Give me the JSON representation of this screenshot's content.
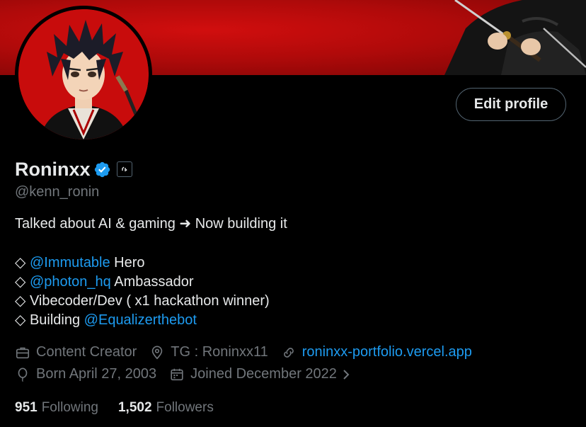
{
  "profile": {
    "display_name": "Roninxx",
    "handle": "@kenn_ronin",
    "edit_button_label": "Edit profile",
    "verified_icon": "verified-badge-icon",
    "affiliate_icon": "affiliate-badge-icon"
  },
  "bio": {
    "line1": "Talked about AI & gaming ➜ Now building it",
    "items": [
      {
        "bullet": "◇",
        "mention": "@Immutable",
        "text": " Hero"
      },
      {
        "bullet": "◇",
        "mention": "@photon_hq",
        "text": " Ambassador"
      },
      {
        "bullet": "◇",
        "mention": "",
        "text": "Vibecoder/Dev ( x1 hackathon winner)"
      },
      {
        "bullet": "◇",
        "pre": "Building ",
        "mention": "@Equalizerthebot",
        "text": ""
      }
    ]
  },
  "meta": {
    "category": "Content Creator",
    "location": "TG : Roninxx11",
    "website": "roninxx-portfolio.vercel.app",
    "birthday": "Born April 27, 2003",
    "joined": "Joined December 2022"
  },
  "stats": {
    "following_count": "951",
    "following_label": "Following",
    "followers_count": "1,502",
    "followers_label": "Followers"
  },
  "colors": {
    "background": "#000000",
    "text_primary": "#e7e9ea",
    "text_secondary": "#71767b",
    "link": "#1d9bf0",
    "banner_red": "#c40c0c"
  }
}
